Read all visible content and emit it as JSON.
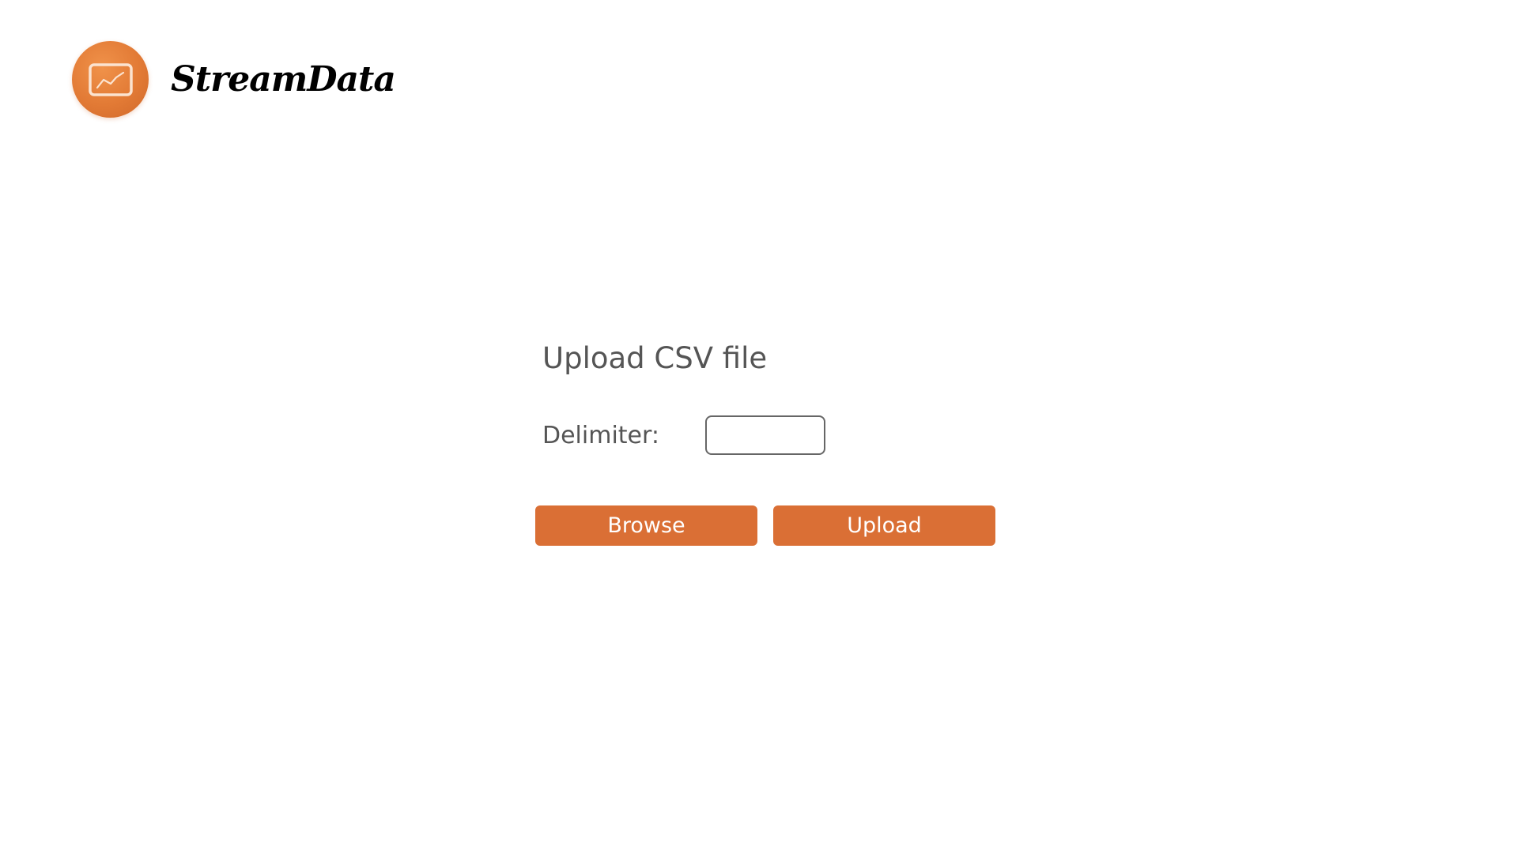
{
  "app": {
    "brand_name": "StreamData",
    "logo_icon": "line-chart-icon",
    "accent_color": "#da6f35"
  },
  "upload": {
    "title": "Upload CSV file",
    "delimiter_label": "Delimiter:",
    "delimiter_value": "",
    "browse_label": "Browse",
    "upload_label": "Upload"
  }
}
